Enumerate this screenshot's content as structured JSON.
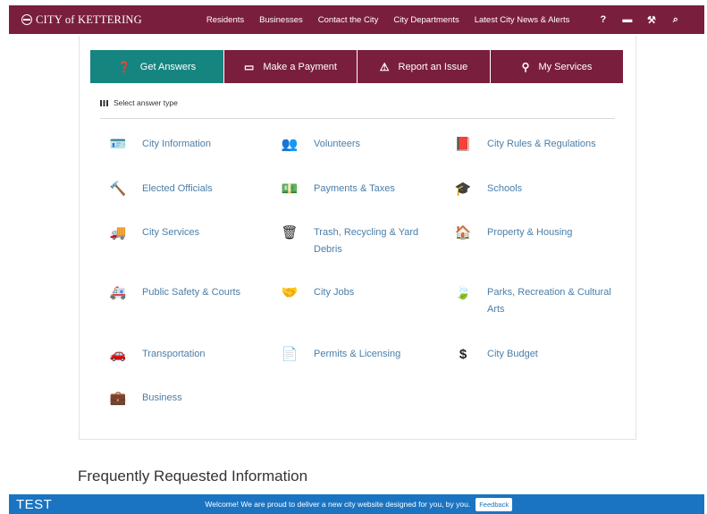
{
  "header": {
    "logo": "CITY of KETTERING",
    "nav": [
      "Residents",
      "Businesses",
      "Contact the City",
      "City Departments",
      "Latest City News & Alerts"
    ],
    "tools": [
      "help-icon",
      "card-icon",
      "wrench-icon",
      "search-icon"
    ]
  },
  "tabs": [
    {
      "label": "Get Answers",
      "icon": "question-circle-icon",
      "active": true
    },
    {
      "label": "Make a Payment",
      "icon": "credit-card-icon",
      "active": false
    },
    {
      "label": "Report an Issue",
      "icon": "warning-icon",
      "active": false
    },
    {
      "label": "My Services",
      "icon": "map-pin-icon",
      "active": false
    }
  ],
  "select_label": "Select answer type",
  "categories": [
    {
      "label": "City Information",
      "icon": "id-card-icon"
    },
    {
      "label": "Volunteers",
      "icon": "users-icon"
    },
    {
      "label": "City Rules & Regulations",
      "icon": "book-icon"
    },
    {
      "label": "Elected Officials",
      "icon": "gavel-icon"
    },
    {
      "label": "Payments & Taxes",
      "icon": "money-icon"
    },
    {
      "label": "Schools",
      "icon": "graduation-cap-icon"
    },
    {
      "label": "City Services",
      "icon": "truck-icon"
    },
    {
      "label": "Trash, Recycling & Yard Debris",
      "icon": "trash-icon"
    },
    {
      "label": "Property & Housing",
      "icon": "home-icon"
    },
    {
      "label": "Public Safety & Courts",
      "icon": "ambulance-icon"
    },
    {
      "label": "City Jobs",
      "icon": "handshake-icon"
    },
    {
      "label": "Parks, Recreation & Cultural Arts",
      "icon": "leaf-icon"
    },
    {
      "label": "Transportation",
      "icon": "car-icon"
    },
    {
      "label": "Permits & Licensing",
      "icon": "document-icon"
    },
    {
      "label": "City Budget",
      "icon": "dollar-icon"
    },
    {
      "label": "Business",
      "icon": "briefcase-icon"
    }
  ],
  "faq_title": "Frequently Requested Information",
  "footer": {
    "test": "TEST",
    "welcome": "Welcome! We are proud to deliver a new city website designed for you, by you.",
    "feedback": "Feedback"
  },
  "colors": {
    "brand": "#7a1e3e",
    "active_tab": "#17857f",
    "link": "#4a7ea8",
    "footer": "#1a74c2"
  }
}
